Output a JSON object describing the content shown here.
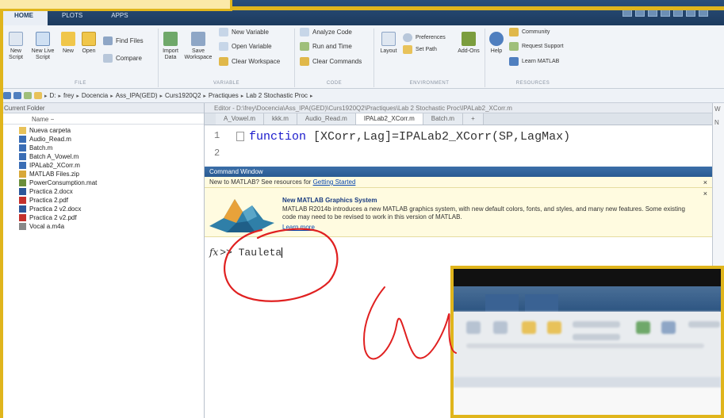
{
  "tabs": [
    {
      "label": "HOME",
      "active": true
    },
    {
      "label": "PLOTS",
      "active": false
    },
    {
      "label": "APPS",
      "active": false
    }
  ],
  "ribbon": {
    "file_group": {
      "label": "FILE",
      "new_script": "New Script",
      "new_live_script": "New Live Script",
      "new": "New",
      "open": "Open",
      "find_files": "Find Files",
      "compare": "Compare"
    },
    "variable_group": {
      "label": "VARIABLE",
      "import_data": "Import Data",
      "save_workspace": "Save Workspace",
      "new_variable": "New Variable",
      "open_variable": "Open Variable",
      "clear_workspace": "Clear Workspace"
    },
    "code_group": {
      "label": "CODE",
      "analyze_code": "Analyze Code",
      "run_and_time": "Run and Time",
      "clear_commands": "Clear Commands"
    },
    "environment_group": {
      "label": "ENVIRONMENT",
      "layout": "Layout",
      "preferences": "Preferences",
      "set_path": "Set Path",
      "add_ons": "Add-Ons"
    },
    "resources_group": {
      "label": "RESOURCES",
      "help": "Help",
      "community": "Community",
      "request_support": "Request Support",
      "learn_matlab": "Learn MATLAB"
    }
  },
  "address": {
    "crumbs": [
      "D:",
      "frey",
      "Docencia",
      "Ass_IPA(GED)",
      "Curs1920Q2",
      "Practiques",
      "Lab 2 Stochastic Proc"
    ]
  },
  "current_folder": {
    "title": "Current Folder",
    "name_header": "Name −",
    "files": [
      {
        "name": "Nueva carpeta",
        "icon": "folder-icon",
        "color": "#e8c25a"
      },
      {
        "name": "Audio_Read.m",
        "icon": "m-file-icon",
        "color": "#3a6db5"
      },
      {
        "name": "Batch.m",
        "icon": "m-file-icon",
        "color": "#3a6db5"
      },
      {
        "name": "Batch A_Vowel.m",
        "icon": "m-file-icon",
        "color": "#3a6db5"
      },
      {
        "name": "IPALab2_XCorr.m",
        "icon": "m-file-icon",
        "color": "#3a6db5"
      },
      {
        "name": "MATLAB Files.zip",
        "icon": "zip-icon",
        "color": "#d8a838"
      },
      {
        "name": "PowerConsumption.mat",
        "icon": "mat-file-icon",
        "color": "#6a8e3a"
      },
      {
        "name": "Practica 2.docx",
        "icon": "word-icon",
        "color": "#2b579a"
      },
      {
        "name": "Practica 2.pdf",
        "icon": "pdf-icon",
        "color": "#c4302b"
      },
      {
        "name": "Practica 2 v2.docx",
        "icon": "word-icon",
        "color": "#2b579a"
      },
      {
        "name": "Practica 2 v2.pdf",
        "icon": "pdf-icon",
        "color": "#c4302b"
      },
      {
        "name": "Vocal a.m4a",
        "icon": "audio-file-icon",
        "color": "#888888"
      }
    ]
  },
  "editor": {
    "title": "Editor - D:\\frey\\Docencia\\Ass_IPA(GED)\\Curs1920Q2\\Practiques\\Lab 2 Stochastic Proc\\IPALab2_XCorr.m",
    "tabs": [
      {
        "label": "A_Vowel.m",
        "active": false
      },
      {
        "label": "kkk.m",
        "active": false
      },
      {
        "label": "Audio_Read.m",
        "active": false
      },
      {
        "label": "IPALab2_XCorr.m",
        "active": true
      },
      {
        "label": "Batch.m",
        "active": false
      }
    ],
    "add_tab": "+",
    "line1_num": "1",
    "line1_kw": "function",
    "line1_code": " [XCorr,Lag]=IPALab2_XCorr(SP,LagMax)",
    "line2_num": "2"
  },
  "command_window": {
    "title": "Command Window",
    "banner_text": "New to MATLAB? See resources for ",
    "banner_link": "Getting Started",
    "news_title": "New MATLAB Graphics System",
    "news_text": "MATLAB R2014b introduces a new MATLAB graphics system, with new default colors, fonts, and styles, and many new features.  Some existing code may need to be revised to work in this version of MATLAB.",
    "news_link": "Learn more",
    "fx": "fx",
    "prompt": ">> ",
    "command": "Tauleta"
  },
  "right_panel": {
    "label": "W",
    "label2": "N"
  },
  "colors": {
    "annotation_ink": "#e02020",
    "frame_yellow": "#e0b51c",
    "title_blue": "#2a5a92"
  }
}
